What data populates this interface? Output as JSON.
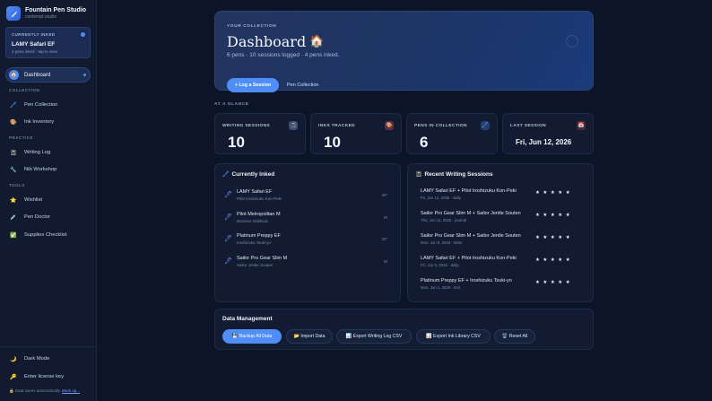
{
  "sidebar": {
    "brand_name": "Fountain Pen Studio",
    "brand_sub": "contempt.studio",
    "currently_inked_label": "CURRENTLY INKED",
    "currently_inked_title": "LAMY Safari EF",
    "currently_inked_sub": "4 pens inked · tap to view",
    "nav_active": "Dashboard",
    "sections": {
      "collection": "COLLECTION",
      "practice": "PRACTICE",
      "tools": "TOOLS"
    },
    "items": {
      "pen_collection": "Pen Collection",
      "ink_inventory": "Ink Inventory",
      "writing_log": "Writing Log",
      "nib_workshop": "Nib Workshop",
      "wishlist": "Wishlist",
      "pen_doctor": "Pen Doctor",
      "supplies_checklist": "Supplies Checklist",
      "dark_mode": "Dark Mode",
      "license": "Enter license key"
    },
    "footer_text": "Data saves automatically.",
    "footer_link": "Back up..."
  },
  "hero": {
    "eyebrow": "YOUR COLLECTION",
    "title": "Dashboard",
    "title_emoji": "🏠",
    "subtitle": "6 pens · 10 sessions logged · 4 pens inked.",
    "primary_button": "+ Log a Session",
    "secondary_button": "Pen Collection"
  },
  "at_a_glance": "AT A GLANCE",
  "stats": [
    {
      "label": "WRITING SESSIONS",
      "value": "10",
      "icon": "notebook-icon",
      "color": "#3a4f7a"
    },
    {
      "label": "INKS TRACKED",
      "value": "10",
      "icon": "palette-icon",
      "color": "#5a2f4a"
    },
    {
      "label": "PENS IN COLLECTION",
      "value": "6",
      "icon": "pen-icon",
      "color": "#24406e"
    },
    {
      "label": "LAST SESSION",
      "value": "Fri, Jun 12, 2026",
      "icon": "calendar-icon",
      "color": "#4a2a36"
    }
  ],
  "currently_inked": {
    "title": "Currently Inked",
    "items": [
      {
        "pen": "LAMY Safari EF",
        "ink": "Pilot Iroshizuku Kon-Peki",
        "nib": "EF"
      },
      {
        "pen": "Pilot Metropolitan M",
        "ink": "Diamine Oxblood",
        "nib": "M"
      },
      {
        "pen": "Platinum Preppy EF",
        "ink": "Iroshizuku Tsuki-yo",
        "nib": "EF"
      },
      {
        "pen": "Sailor Pro Gear Slim M",
        "ink": "Sailor Jentle Souten",
        "nib": "M"
      }
    ]
  },
  "recent_sessions": {
    "title": "Recent Writing Sessions",
    "items": [
      {
        "title": "LAMY Safari EF + Pilot Iroshizuku Kon-Peki",
        "meta": "Fri, Jun 12, 2026 · daily",
        "stars": "★★★★★"
      },
      {
        "title": "Sailor Pro Gear Slim M + Sailor Jentle Souten",
        "meta": "Thu, Jun 11, 2026 · journal",
        "stars": "★★★★★"
      },
      {
        "title": "Sailor Pro Gear Slim M + Sailor Jentle Souten",
        "meta": "Mon, Jun 8, 2026 · letter",
        "stars": "★★★★★"
      },
      {
        "title": "LAMY Safari EF + Pilot Iroshizuku Kon-Peki",
        "meta": "Fri, Jun 5, 2026 · daily",
        "stars": "★★★★★"
      },
      {
        "title": "Platinum Preppy EF + Iroshizuku Tsuki-yo",
        "meta": "Mon, Jun 1, 2026 · test",
        "stars": "★★★★★"
      }
    ]
  },
  "data_management": {
    "title": "Data Management",
    "buttons": {
      "backup": "💾 Backup All Data",
      "import": "📂 Import Data",
      "export_log": "📊 Export Writing Log CSV",
      "export_ink": "📊 Export Ink Library CSV",
      "reset": "🗑️ Reset All"
    }
  },
  "colors": {
    "accent": "#4f8ef7",
    "background": "#0c1428",
    "panel": "#121b31"
  }
}
